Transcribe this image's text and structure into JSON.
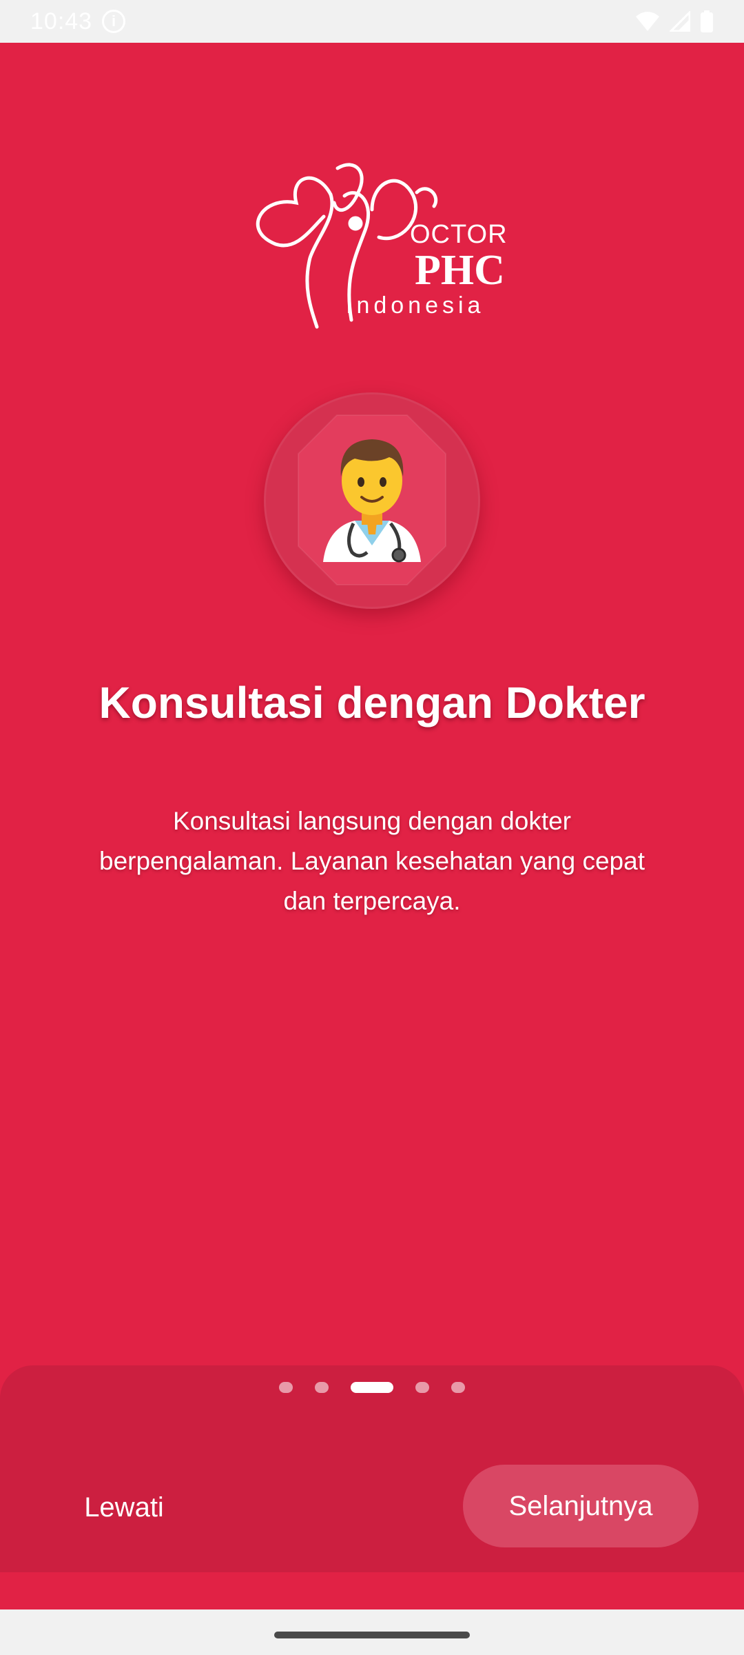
{
  "status_bar": {
    "time": "10:43",
    "info_icon": "info-icon",
    "wifi_icon": "wifi-icon",
    "signal_icon": "signal-icon",
    "battery_icon": "battery-icon"
  },
  "logo": {
    "line1": "OCTOR",
    "line2": "PHC",
    "line3": "Indonesia"
  },
  "onboarding": {
    "illustration_icon": "doctor-icon",
    "title": "Konsultasi dengan Dokter",
    "description": "Konsultasi langsung dengan dokter berpengalaman. Layanan kesehatan yang cepat dan terpercaya."
  },
  "pager": {
    "total_pages": 5,
    "active_page": 3
  },
  "actions": {
    "skip_label": "Lewati",
    "next_label": "Selanjutnya"
  },
  "colors": {
    "primary_red": "#e12245",
    "panel_red": "#cc1f40",
    "button_pink": "#d94764"
  }
}
